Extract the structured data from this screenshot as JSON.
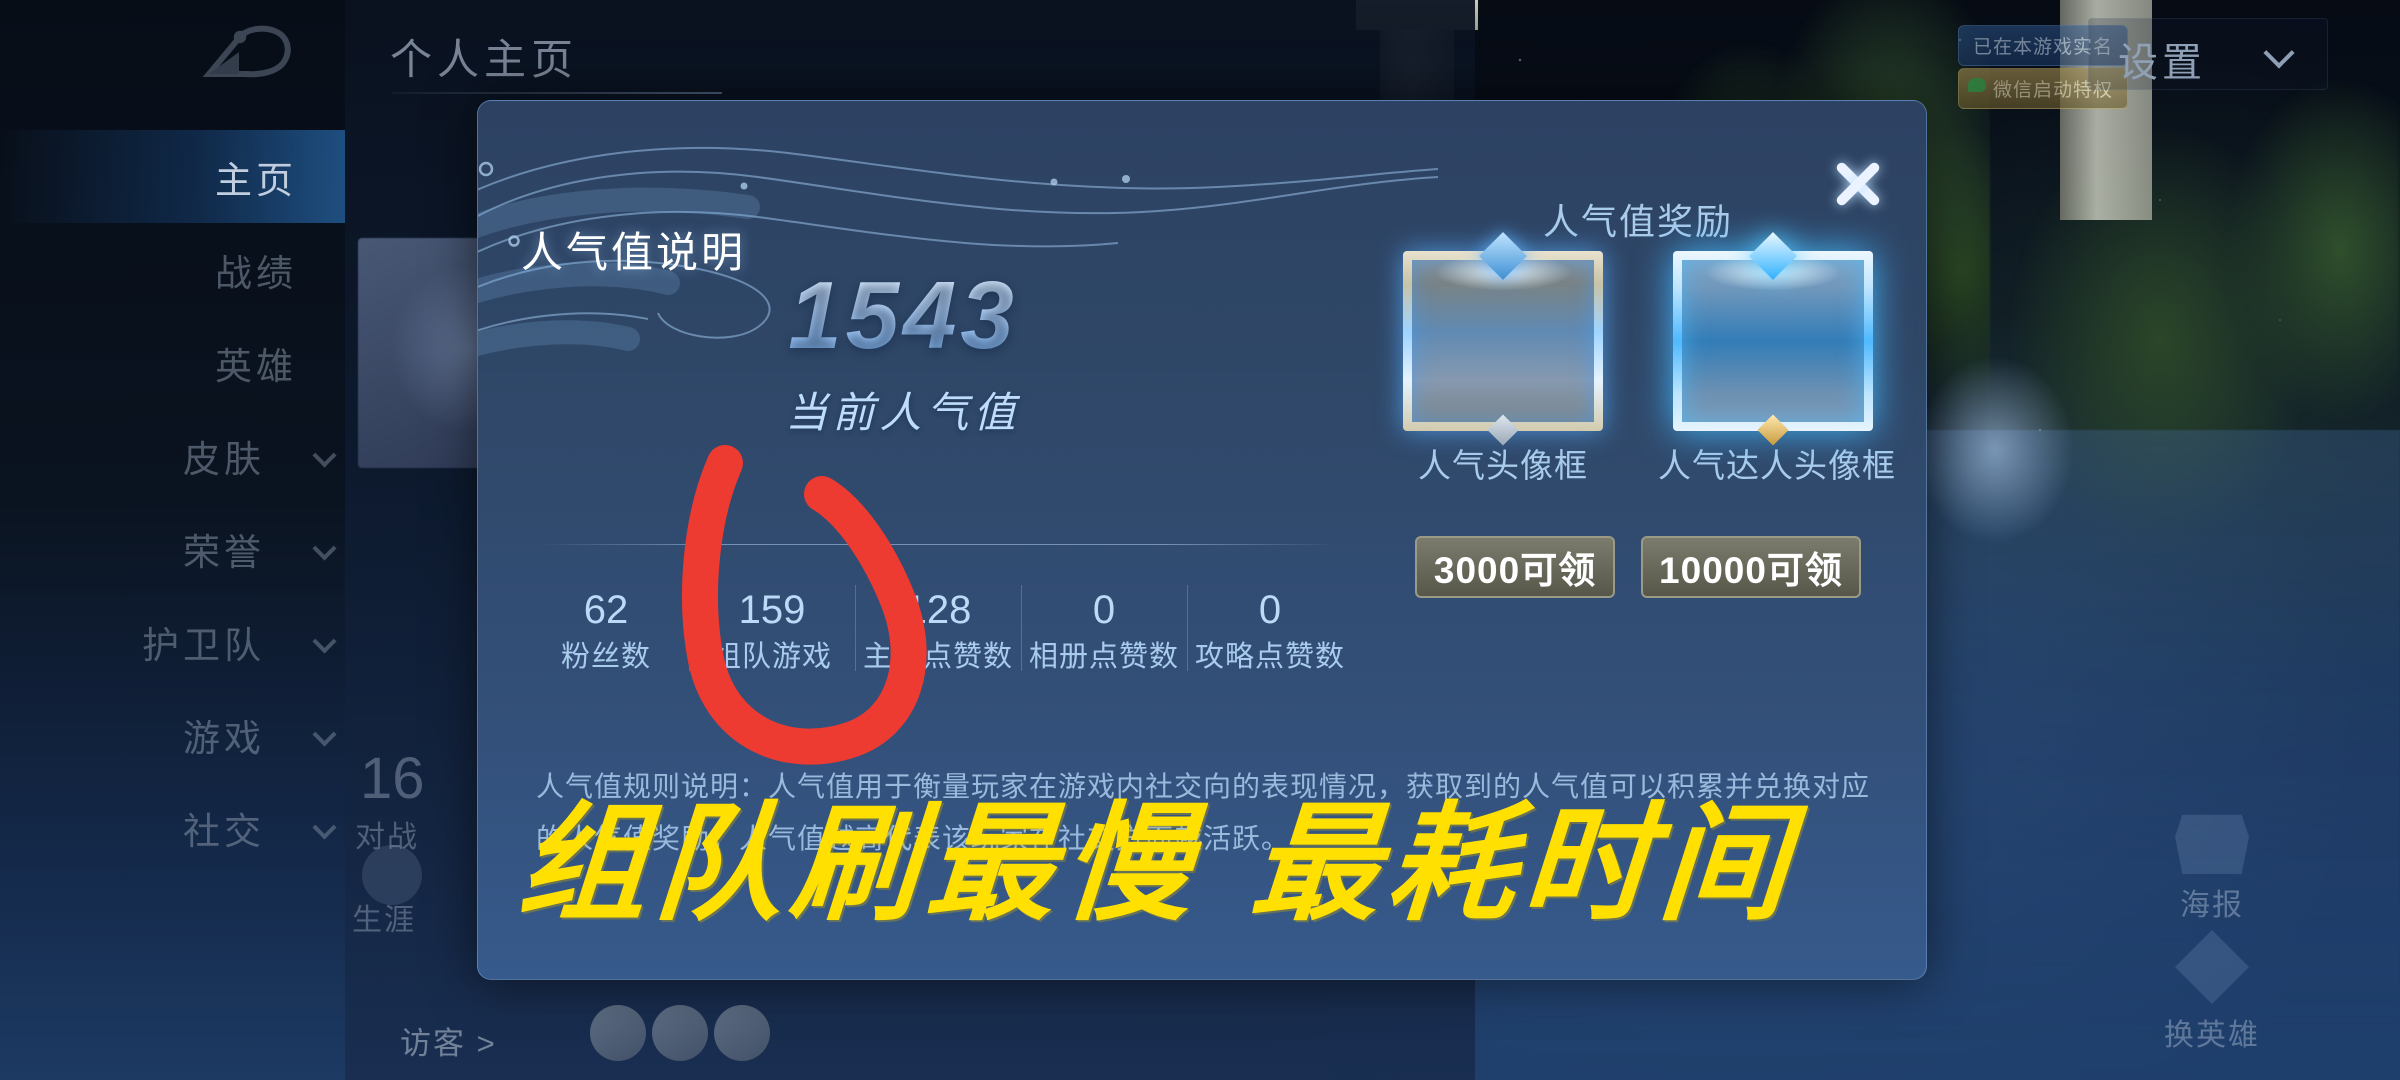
{
  "topbar": {
    "back_icon": "back-arrow-icon",
    "page_title": "个人主页",
    "badge_realname": "已在本游戏实名",
    "badge_wechat": "微信启动特权",
    "settings_label": "设置",
    "settings_chevron": "chevron-down-icon"
  },
  "sidebar": {
    "items": [
      {
        "label": "主页",
        "active": true,
        "expandable": false
      },
      {
        "label": "战绩",
        "active": false,
        "expandable": false
      },
      {
        "label": "英雄",
        "active": false,
        "expandable": false
      },
      {
        "label": "皮肤",
        "active": false,
        "expandable": true
      },
      {
        "label": "荣誉",
        "active": false,
        "expandable": true
      },
      {
        "label": "护卫队",
        "active": false,
        "expandable": true
      },
      {
        "label": "游戏",
        "active": false,
        "expandable": true
      },
      {
        "label": "社交",
        "active": false,
        "expandable": true
      }
    ]
  },
  "background_profile": {
    "stat_number": "16",
    "stat_label": "对战",
    "career_label": "生涯",
    "visitors_label": "访客 >",
    "visitor_count": 3
  },
  "side_buttons": [
    {
      "label": "海报",
      "icon": "poster-icon"
    },
    {
      "label": "换英雄",
      "icon": "swap-hero-icon"
    }
  ],
  "modal": {
    "title": "人气值说明",
    "close_icon": "close-icon",
    "value": "1543",
    "value_label": "当前人气值",
    "stats": [
      {
        "number": "62",
        "label": "粉丝数"
      },
      {
        "number": "159",
        "label": "组队游戏"
      },
      {
        "number": "128",
        "label": "主页点赞数"
      },
      {
        "number": "0",
        "label": "相册点赞数"
      },
      {
        "number": "0",
        "label": "攻略点赞数"
      }
    ],
    "rewards_title": "人气值奖励",
    "rewards": [
      {
        "name": "人气头像框",
        "button": "3000可领",
        "icon": "avatar-frame-popular-icon"
      },
      {
        "name": "人气达人头像框",
        "button": "10000可领",
        "icon": "avatar-frame-elite-icon"
      }
    ],
    "rules_text": "人气值规则说明：人气值用于衡量玩家在游戏内社交向的表现情况，获取到的人气值可以积累并兑换对应的人气值奖励，人气值越高代表该玩家在社交方面越活跃。"
  },
  "annotation": {
    "text": "组队刷最慢 最耗时间",
    "text_color": "#ffe000",
    "mark_color": "#ee3b32",
    "mark_shape": "hand-drawn-circle-around-team-games-stat"
  },
  "colors": {
    "modal_bg_top": "#2d4263",
    "modal_bg_bottom": "#365a8c",
    "accent_blue": "#bcdaf8",
    "value_blue": "#8fc4f2",
    "annotation_yellow": "#ffe000",
    "annotation_red": "#ee3b32"
  }
}
